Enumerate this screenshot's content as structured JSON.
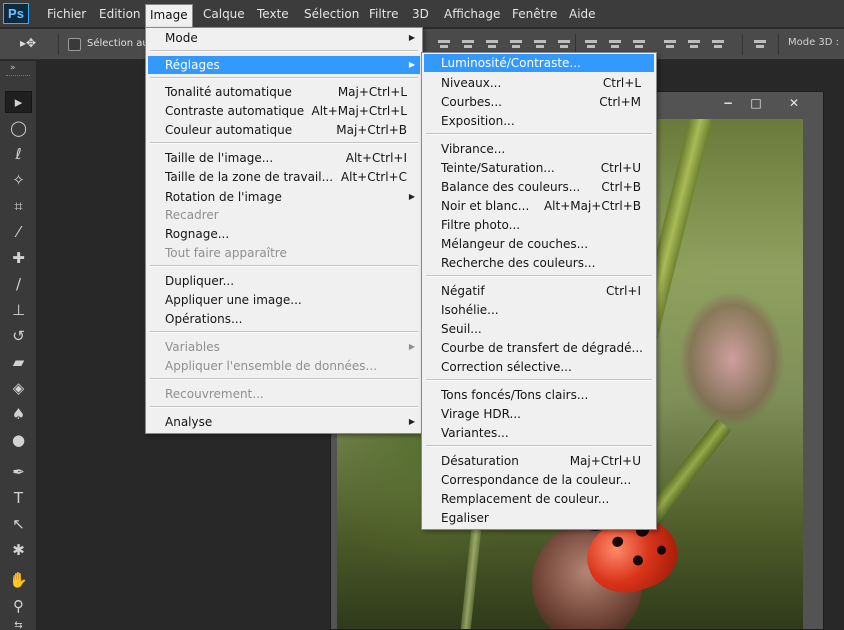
{
  "app": {
    "logo": "Ps"
  },
  "menubar": [
    {
      "label": "Fichier"
    },
    {
      "label": "Edition"
    },
    {
      "label": "Image"
    },
    {
      "label": "Calque"
    },
    {
      "label": "Texte"
    },
    {
      "label": "Sélection"
    },
    {
      "label": "Filtre"
    },
    {
      "label": "3D"
    },
    {
      "label": "Affichage"
    },
    {
      "label": "Fenêtre"
    },
    {
      "label": "Aide"
    }
  ],
  "options_bar": {
    "auto_select_label": "Sélection auto.",
    "mode3d_label": "Mode 3D :"
  },
  "tools": [
    {
      "icon": "move-icon"
    },
    {
      "icon": "marquee-icon"
    },
    {
      "icon": "lasso-icon"
    },
    {
      "icon": "magic-wand-icon"
    },
    {
      "icon": "crop-icon"
    },
    {
      "icon": "eyedropper-icon"
    },
    {
      "icon": "healing-brush-icon"
    },
    {
      "icon": "brush-icon"
    },
    {
      "icon": "clone-stamp-icon"
    },
    {
      "icon": "history-brush-icon"
    },
    {
      "icon": "eraser-icon"
    },
    {
      "icon": "paint-bucket-icon"
    },
    {
      "icon": "blur-icon"
    },
    {
      "icon": "dodge-icon"
    },
    {
      "icon": "pen-icon"
    },
    {
      "icon": "type-icon",
      "glyph": "T"
    },
    {
      "icon": "path-selection-icon"
    },
    {
      "icon": "custom-shape-icon"
    },
    {
      "icon": "hand-icon"
    },
    {
      "icon": "zoom-icon"
    }
  ],
  "image_menu": {
    "items": [
      {
        "label": "Mode",
        "submenu": true
      },
      {
        "label": "Réglages",
        "submenu": true,
        "highlighted": true
      },
      {
        "label": "Tonalité automatique",
        "shortcut": "Maj+Ctrl+L"
      },
      {
        "label": "Contraste automatique",
        "shortcut": "Alt+Maj+Ctrl+L"
      },
      {
        "label": "Couleur automatique",
        "shortcut": "Maj+Ctrl+B"
      },
      {
        "label": "Taille de l'image...",
        "shortcut": "Alt+Ctrl+I"
      },
      {
        "label": "Taille de la zone de travail...",
        "shortcut": "Alt+Ctrl+C"
      },
      {
        "label": "Rotation de l'image",
        "submenu": true
      },
      {
        "label": "Recadrer",
        "disabled": true
      },
      {
        "label": "Rognage..."
      },
      {
        "label": "Tout faire apparaître",
        "disabled": true
      },
      {
        "label": "Dupliquer..."
      },
      {
        "label": "Appliquer une image..."
      },
      {
        "label": "Opérations..."
      },
      {
        "label": "Variables",
        "submenu": true,
        "disabled": true
      },
      {
        "label": "Appliquer l'ensemble de données...",
        "disabled": true
      },
      {
        "label": "Recouvrement...",
        "disabled": true
      },
      {
        "label": "Analyse",
        "submenu": true
      }
    ]
  },
  "adjustments_menu": {
    "items": [
      {
        "label": "Luminosité/Contraste...",
        "highlighted": true
      },
      {
        "label": "Niveaux...",
        "shortcut": "Ctrl+L"
      },
      {
        "label": "Courbes...",
        "shortcut": "Ctrl+M"
      },
      {
        "label": "Exposition..."
      },
      {
        "label": "Vibrance..."
      },
      {
        "label": "Teinte/Saturation...",
        "shortcut": "Ctrl+U"
      },
      {
        "label": "Balance des couleurs...",
        "shortcut": "Ctrl+B"
      },
      {
        "label": "Noir et blanc...",
        "shortcut": "Alt+Maj+Ctrl+B"
      },
      {
        "label": "Filtre photo..."
      },
      {
        "label": "Mélangeur de couches..."
      },
      {
        "label": "Recherche des couleurs..."
      },
      {
        "label": "Négatif",
        "shortcut": "Ctrl+I"
      },
      {
        "label": "Isohélie..."
      },
      {
        "label": "Seuil..."
      },
      {
        "label": "Courbe de transfert de dégradé..."
      },
      {
        "label": "Correction sélective..."
      },
      {
        "label": "Tons foncés/Tons clairs..."
      },
      {
        "label": "Virage HDR..."
      },
      {
        "label": "Variantes..."
      },
      {
        "label": "Désaturation",
        "shortcut": "Maj+Ctrl+U"
      },
      {
        "label": "Correspondance de la couleur..."
      },
      {
        "label": "Remplacement de couleur..."
      },
      {
        "label": "Egaliser"
      }
    ]
  },
  "document": {
    "window_buttons": [
      "−",
      "□",
      "✕"
    ]
  },
  "colors": {
    "highlight": "#3399ff",
    "menu_bg": "#f0f0f0",
    "chrome": "#3c3c3c",
    "canvas": "#282828"
  }
}
